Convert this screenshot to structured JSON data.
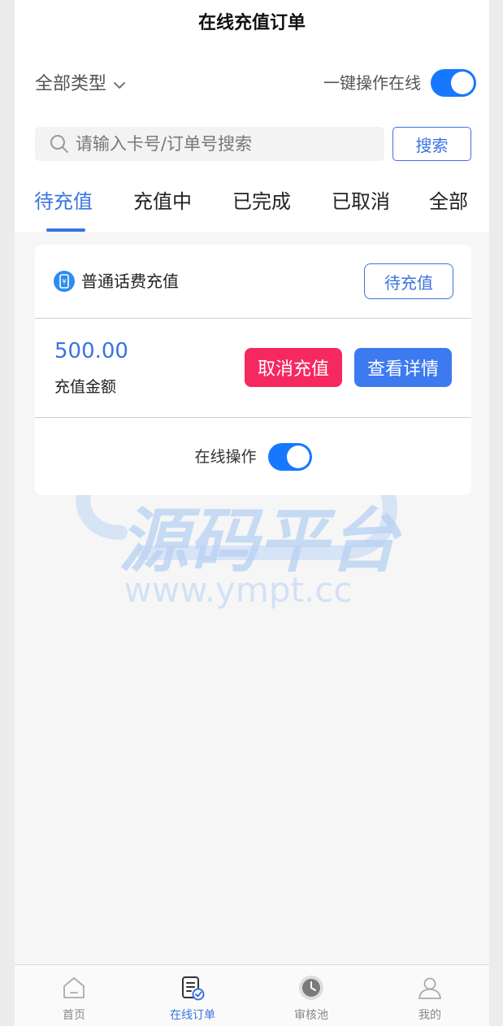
{
  "header": {
    "title": "在线充值订单",
    "filter_type": "全部类型",
    "toggle_all_label": "一键操作在线",
    "toggle_all_on": true
  },
  "search": {
    "placeholder": "请输入卡号/订单号搜索",
    "value": "",
    "button_label": "搜索"
  },
  "tabs": [
    {
      "label": "待充值",
      "active": true
    },
    {
      "label": "充值中",
      "active": false
    },
    {
      "label": "已完成",
      "active": false
    },
    {
      "label": "已取消",
      "active": false
    },
    {
      "label": "全部",
      "active": false
    }
  ],
  "orders": [
    {
      "type_icon": "phone-yuan-icon",
      "type_label": "普通话费充值",
      "status": "待充值",
      "amount": "500.00",
      "amount_label": "充值金额",
      "cancel_label": "取消充值",
      "detail_label": "查看详情",
      "online_label": "在线操作",
      "online_on": true
    }
  ],
  "watermark": {
    "text": "源码平台",
    "url": "www.ympt.cc"
  },
  "tabbar": [
    {
      "label": "首页",
      "icon": "home-icon",
      "active": false
    },
    {
      "label": "在线订单",
      "icon": "order-list-icon",
      "active": true
    },
    {
      "label": "审核池",
      "icon": "clock-icon",
      "active": false
    },
    {
      "label": "我的",
      "icon": "user-icon",
      "active": false
    }
  ],
  "colors": {
    "accent": "#3a74e0",
    "toggle": "#1677ff",
    "danger": "#f5285f"
  }
}
